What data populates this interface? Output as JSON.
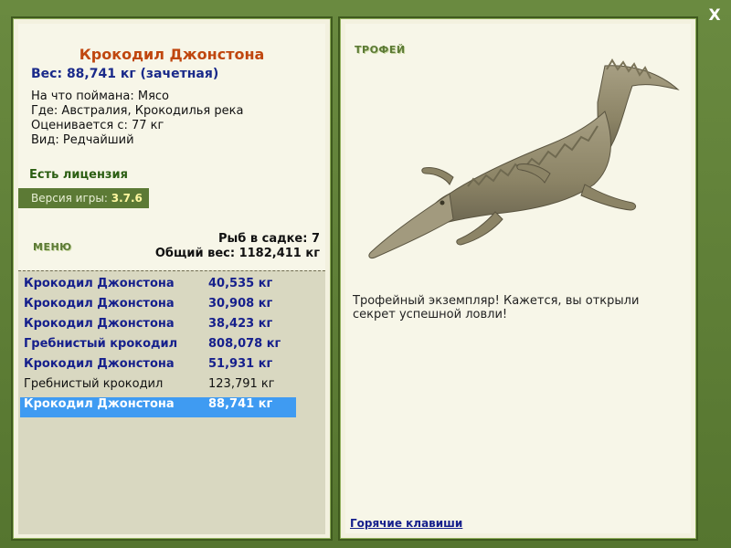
{
  "window": {
    "close_label": "X"
  },
  "fish": {
    "name": "Крокодил Джонстона",
    "weight": "Вес: 88,741 кг (зачетная)",
    "caught_on": "На что поймана: Мясо",
    "location": "Где: Австралия, Крокодилья река",
    "value": "Оценивается с: 77 кг",
    "rarity": "Вид: Редчайший"
  },
  "license": "Есть лицензия",
  "version": {
    "label": "Версия игры: ",
    "value": "3.7.6"
  },
  "menu_label": "МЕНЮ",
  "keepnet": {
    "count": "Рыб в садке: 7",
    "total_weight": "Общий вес: 1182,411 кг"
  },
  "catch_list": [
    {
      "name": "Крокодил Джонстона",
      "weight": "40,535 кг"
    },
    {
      "name": "Крокодил Джонстона",
      "weight": "30,908 кг"
    },
    {
      "name": "Крокодил Джонстона",
      "weight": "38,423 кг"
    },
    {
      "name": "Гребнистый крокодил",
      "weight": "808,078 кг"
    },
    {
      "name": "Крокодил Джонстона",
      "weight": "51,931 кг"
    },
    {
      "name": "Гребнистый крокодил",
      "weight": "123,791 кг"
    },
    {
      "name": "Крокодил Джонстона",
      "weight": "88,741 кг"
    }
  ],
  "trophy": {
    "label": "ТРОФЕЙ",
    "description": "Трофейный экземпляр! Кажется, вы открыли секрет успешной ловли!"
  },
  "hotkeys_label": "Горячие клавиши",
  "icons": {
    "close": "close-icon",
    "trophy_image": "crocodile-image"
  }
}
